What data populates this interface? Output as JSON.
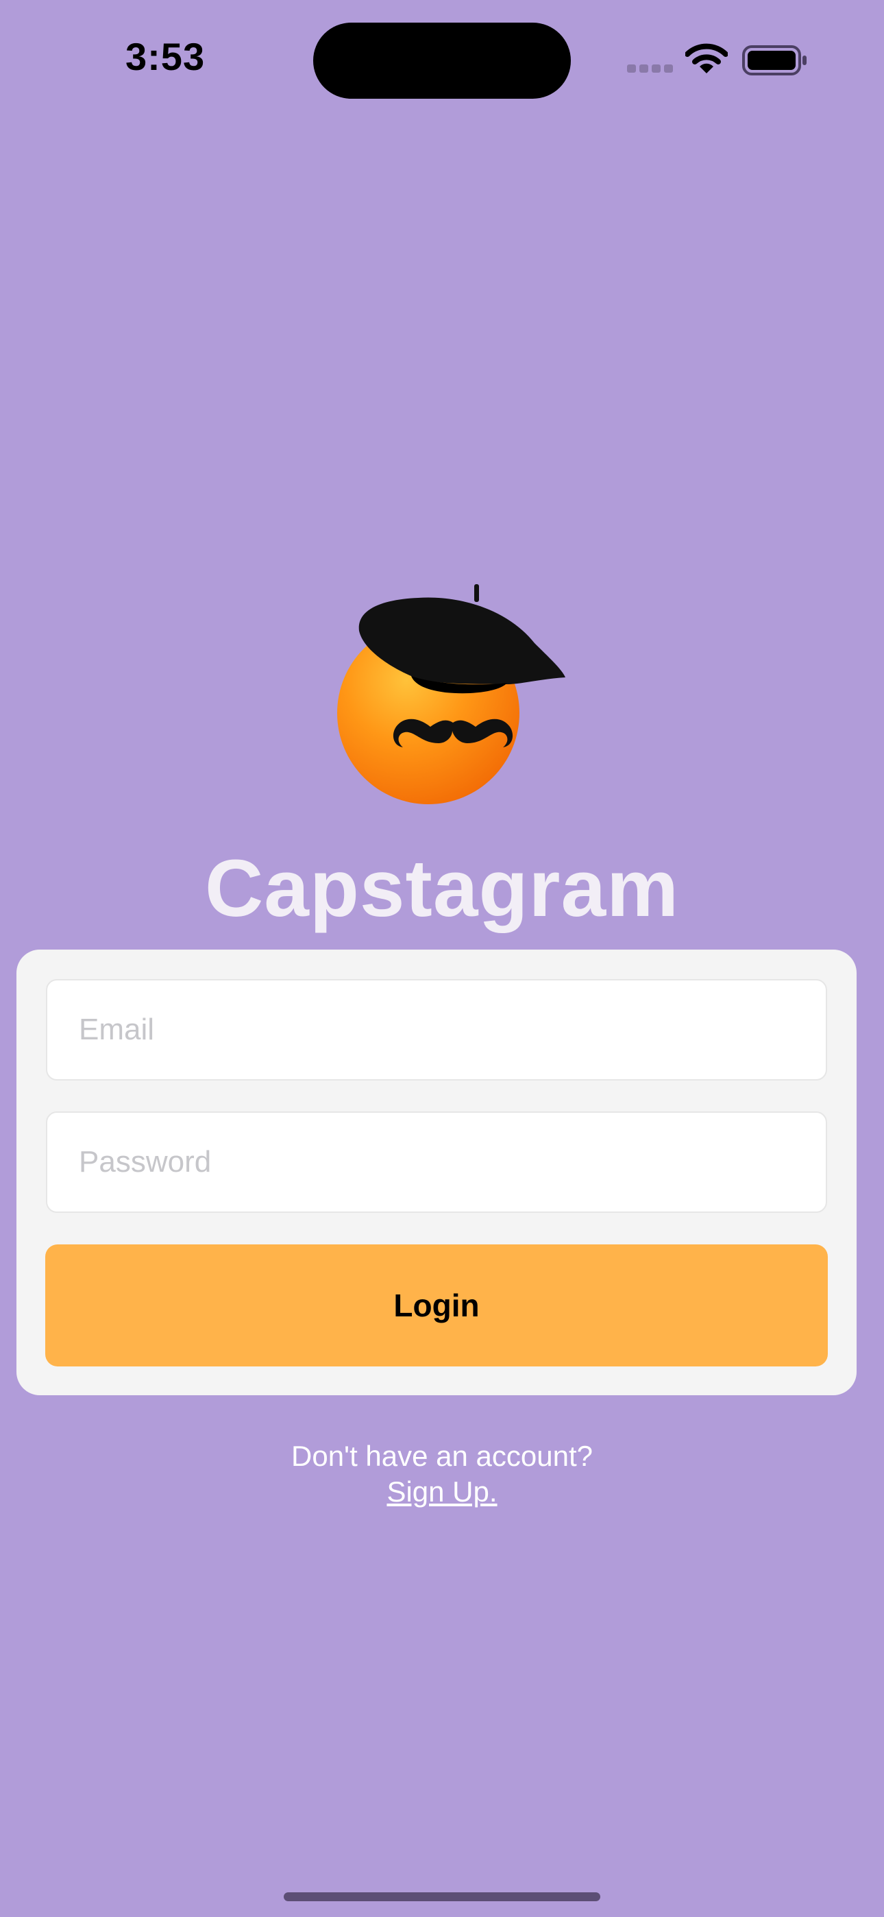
{
  "status_bar": {
    "time": "3:53",
    "icons": [
      "cellular-signal-icon",
      "wifi-icon",
      "battery-icon"
    ]
  },
  "logo": {
    "icon": "orange-with-beret-and-mustache-icon",
    "alt": "Capstagram mascot"
  },
  "app": {
    "title": "Capstagram"
  },
  "login_form": {
    "email_placeholder": "Email",
    "email_value": "",
    "password_placeholder": "Password",
    "password_value": "",
    "login_label": "Login"
  },
  "signup": {
    "prompt": "Don't have an account?",
    "link_label": "Sign Up."
  },
  "colors": {
    "background": "#B19CD9",
    "card": "#F4F4F4",
    "accent": "#FFB34A",
    "title": "#F2EEF6"
  }
}
